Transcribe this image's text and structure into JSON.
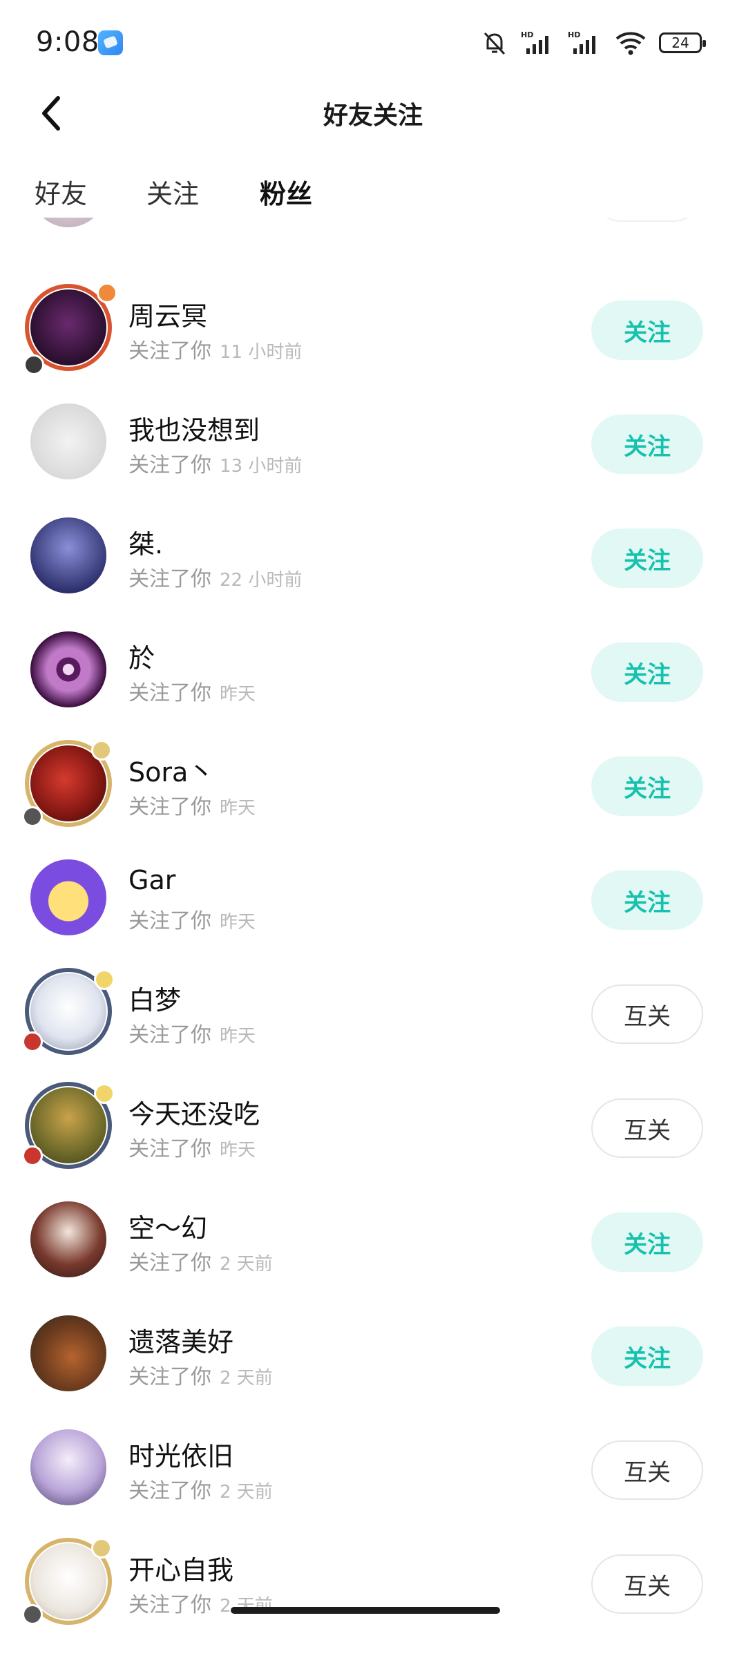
{
  "status_bar": {
    "time": "9:08",
    "battery": "24"
  },
  "header": {
    "title": "好友关注"
  },
  "tabs": [
    {
      "label": "好友",
      "active": false
    },
    {
      "label": "关注",
      "active": false
    },
    {
      "label": "粉丝",
      "active": true
    }
  ],
  "accent_color": "#22d3bf",
  "followers": [
    {
      "name": "周云冥",
      "action": "关注了你",
      "time": "11 小时前",
      "button": "关注",
      "button_type": "follow"
    },
    {
      "name": "我也没想到",
      "action": "关注了你",
      "time": "13 小时前",
      "button": "关注",
      "button_type": "follow"
    },
    {
      "name": "桀.",
      "action": "关注了你",
      "time": "22 小时前",
      "button": "关注",
      "button_type": "follow"
    },
    {
      "name": "於",
      "action": "关注了你",
      "time": "昨天",
      "button": "关注",
      "button_type": "follow"
    },
    {
      "name": "Sora丶",
      "action": "关注了你",
      "time": "昨天",
      "button": "关注",
      "button_type": "follow"
    },
    {
      "name": "Gar",
      "action": "关注了你",
      "time": "昨天",
      "button": "关注",
      "button_type": "follow"
    },
    {
      "name": "白梦",
      "action": "关注了你",
      "time": "昨天",
      "button": "互关",
      "button_type": "mutual"
    },
    {
      "name": "今天还没吃",
      "action": "关注了你",
      "time": "昨天",
      "button": "互关",
      "button_type": "mutual"
    },
    {
      "name": "空～幻",
      "action": "关注了你",
      "time": "2 天前",
      "button": "关注",
      "button_type": "follow"
    },
    {
      "name": "遗落美好",
      "action": "关注了你",
      "time": "2 天前",
      "button": "关注",
      "button_type": "follow"
    },
    {
      "name": "时光依旧",
      "action": "关注了你",
      "time": "2 天前",
      "button": "互关",
      "button_type": "mutual"
    },
    {
      "name": "开心自我",
      "action": "关注了你",
      "time": "2 天前",
      "button": "互关",
      "button_type": "mutual"
    }
  ]
}
